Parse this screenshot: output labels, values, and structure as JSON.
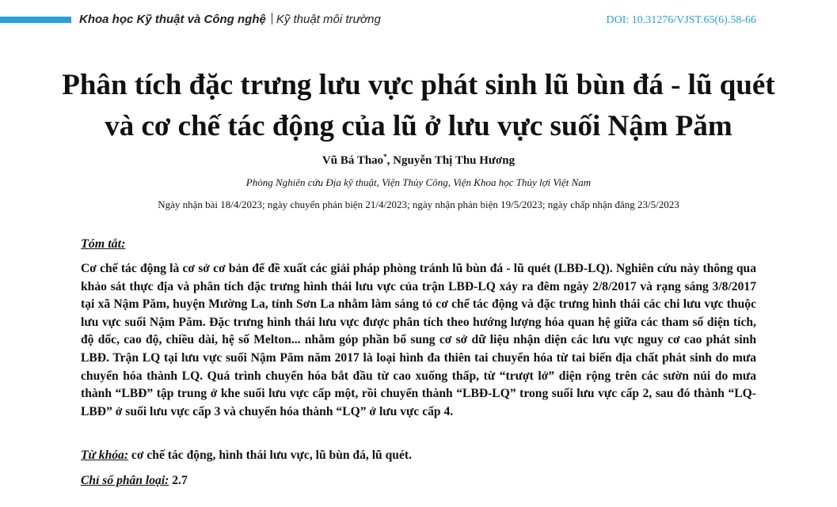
{
  "header": {
    "accent_color": "#2a9fd8",
    "journal_section": "Khoa học Kỹ thuật và Công nghệ",
    "journal_subsection": "Kỹ thuật môi trường",
    "doi": "DOI: 10.31276/VJST.65(6).58-66"
  },
  "article": {
    "title_line1": "Phân tích đặc trưng lưu vực phát sinh lũ bùn đá - lũ quét",
    "title_line2": "và cơ chế tác động của lũ ở lưu vực suối Nậm Păm",
    "author1": "Vũ Bá Thao",
    "author1_mark": "*",
    "author2": ", Nguyễn Thị Thu Hương",
    "affiliation": "Phòng Nghiên cứu Địa kỹ thuật, Viện Thủy Công, Viện Khoa học Thủy lợi Việt Nam",
    "dates": "Ngày nhận bài 18/4/2023; ngày chuyển phản biện 21/4/2023; ngày nhận phản biện 19/5/2023; ngày chấp nhận đăng 23/5/2023"
  },
  "abstract": {
    "heading": "Tóm tắt:",
    "text": "Cơ chế tác động là cơ sở cơ bản để đề xuất các giải pháp phòng tránh lũ bùn đá - lũ quét (LBĐ-LQ). Nghiên cứu này thông qua khảo sát thực địa và phân tích đặc trưng hình thái lưu vực của trận LBĐ-LQ xảy ra đêm ngày 2/8/2017 và rạng sáng 3/8/2017 tại xã Nậm Păm, huyện Mường La, tỉnh Sơn La nhằm làm sáng tỏ cơ chế tác động và đặc trưng hình thái các chi lưu vực thuộc lưu vực suối Nậm Păm. Đặc trưng hình thái lưu vực được phân tích theo hướng lượng hóa quan hệ giữa các tham số diện tích, độ dốc, cao độ, chiều dài, hệ số Melton... nhằm góp phần bổ sung cơ sở dữ liệu nhận diện các lưu vực nguy cơ cao phát sinh LBĐ. Trận LQ tại lưu vực suối Nậm Păm năm 2017 là loại hình đa thiên tai chuyển hóa từ tai biến địa chất phát sinh do mưa chuyển hóa thành LQ. Quá trình chuyển hóa bắt đầu từ cao xuống thấp, từ “trượt lở” diện rộng trên các sườn núi do mưa thành “LBĐ” tập trung ở khe suối lưu vực cấp một, rồi chuyển thành “LBĐ-LQ” trong suối lưu vực cấp 2, sau đó thành “LQ-LBĐ” ở suối lưu vực cấp 3 và chuyển hóa thành “LQ” ở lưu vực cấp 4."
  },
  "keywords": {
    "label": "Từ khóa:",
    "value": " cơ chế tác động, hình thái lưu vực, lũ bùn đá, lũ quét."
  },
  "classification": {
    "label": "Chỉ số phân loại:",
    "value": " 2.7"
  }
}
